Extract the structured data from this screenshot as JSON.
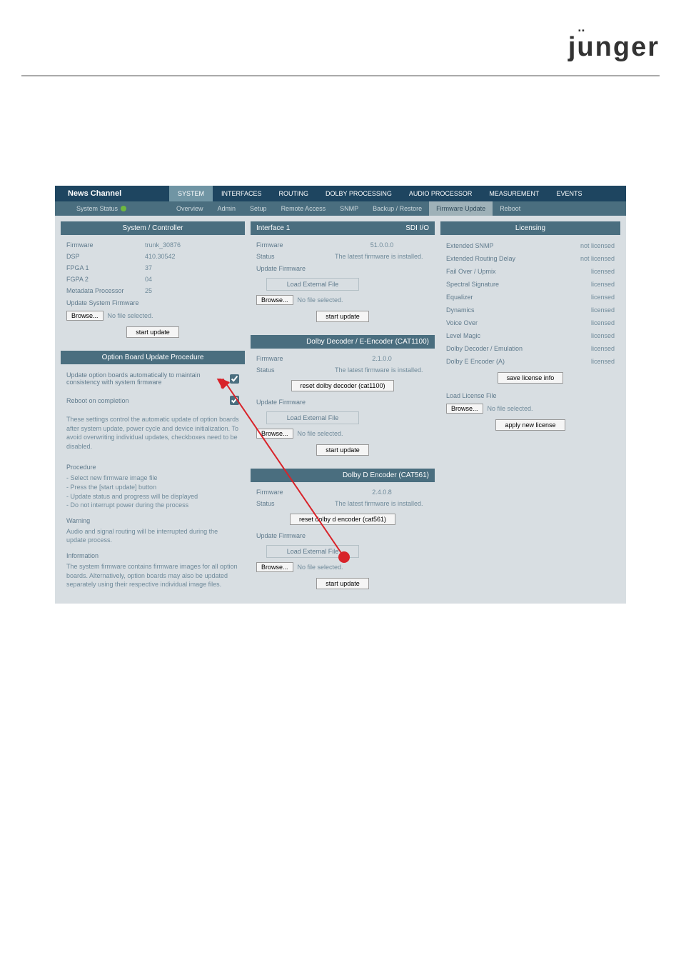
{
  "brand": "jünger",
  "device_name": "News Channel",
  "system_status_label": "System Status",
  "main_tabs": [
    "SYSTEM",
    "INTERFACES",
    "ROUTING",
    "DOLBY PROCESSING",
    "AUDIO PROCESSOR",
    "MEASUREMENT",
    "EVENTS"
  ],
  "sub_tabs": [
    "Overview",
    "Admin",
    "Setup",
    "Remote Access",
    "SNMP",
    "Backup / Restore",
    "Firmware Update",
    "Reboot"
  ],
  "sys_controller": {
    "title": "System / Controller",
    "rows": {
      "firmware_lbl": "Firmware",
      "firmware_val": "trunk_30876",
      "dsp_lbl": "DSP",
      "dsp_val": "410.30542",
      "fpga1_lbl": "FPGA 1",
      "fpga1_val": "37",
      "fpga2_lbl": "FGPA 2",
      "fpga2_val": "04",
      "meta_lbl": "Metadata Processor",
      "meta_val": "25"
    },
    "update_link": "Update System Firmware",
    "browse": "Browse...",
    "no_file": "No file selected.",
    "start": "start update"
  },
  "option_board": {
    "title": "Option Board Update Procedure",
    "auto_update": "Update option boards automatically to maintain consistency with system firmware",
    "reboot": "Reboot on completion",
    "note": "These settings control the automatic update of option boards after system update, power cycle and device initialization. To avoid overwriting individual updates, checkboxes need to be disabled.",
    "procedure_title": "Procedure",
    "procedure": "- Select new firmware image file\n- Press the [start update] button\n- Update status and progress will be displayed\n- Do not interrupt power during the process",
    "warning_title": "Warning",
    "warning": "Audio and signal routing will be interrupted during the update process.",
    "info_title": "Information",
    "info": "The system firmware contains firmware images for all option boards. Alternatively, option boards may also be updated separately using their respective individual image files."
  },
  "interface1": {
    "title": "Interface 1",
    "right": "SDI I/O",
    "firmware_lbl": "Firmware",
    "firmware_val": "51.0.0.0",
    "status_lbl": "Status",
    "status_val": "The latest firmware is installed.",
    "update": "Update Firmware",
    "load_ext": "Load External File",
    "browse": "Browse...",
    "no_file": "No file selected.",
    "start": "start update"
  },
  "dolby_dec": {
    "title": "Dolby Decoder / E-Encoder (CAT1100)",
    "firmware_lbl": "Firmware",
    "firmware_val": "2.1.0.0",
    "status_lbl": "Status",
    "status_val": "The latest firmware is installed.",
    "reset": "reset dolby decoder (cat1100)",
    "update": "Update Firmware",
    "load_ext": "Load External File",
    "browse": "Browse...",
    "no_file": "No file selected.",
    "start": "start update"
  },
  "dolby_d": {
    "title": "Dolby D Encoder (CAT561)",
    "firmware_lbl": "Firmware",
    "firmware_val": "2.4.0.8",
    "status_lbl": "Status",
    "status_val": "The latest firmware is installed.",
    "reset": "reset dolby d encoder (cat561)",
    "update": "Update Firmware",
    "load_ext": "Load External File",
    "browse": "Browse...",
    "no_file": "No file selected.",
    "start": "start update"
  },
  "licensing": {
    "title": "Licensing",
    "items": [
      {
        "name": "Extended SNMP",
        "state": "not licensed"
      },
      {
        "name": "Extended Routing Delay",
        "state": "not licensed"
      },
      {
        "name": "Fail Over / Upmix",
        "state": "licensed"
      },
      {
        "name": "Spectral Signature",
        "state": "licensed"
      },
      {
        "name": "Equalizer",
        "state": "licensed"
      },
      {
        "name": "Dynamics",
        "state": "licensed"
      },
      {
        "name": "Voice Over",
        "state": "licensed"
      },
      {
        "name": "Level Magic",
        "state": "licensed"
      },
      {
        "name": "Dolby Decoder / Emulation",
        "state": "licensed"
      },
      {
        "name": "Dolby E Encoder (A)",
        "state": "licensed"
      }
    ],
    "save": "save license info",
    "load_title": "Load License File",
    "browse": "Browse...",
    "no_file": "No file selected.",
    "apply": "apply new license"
  }
}
